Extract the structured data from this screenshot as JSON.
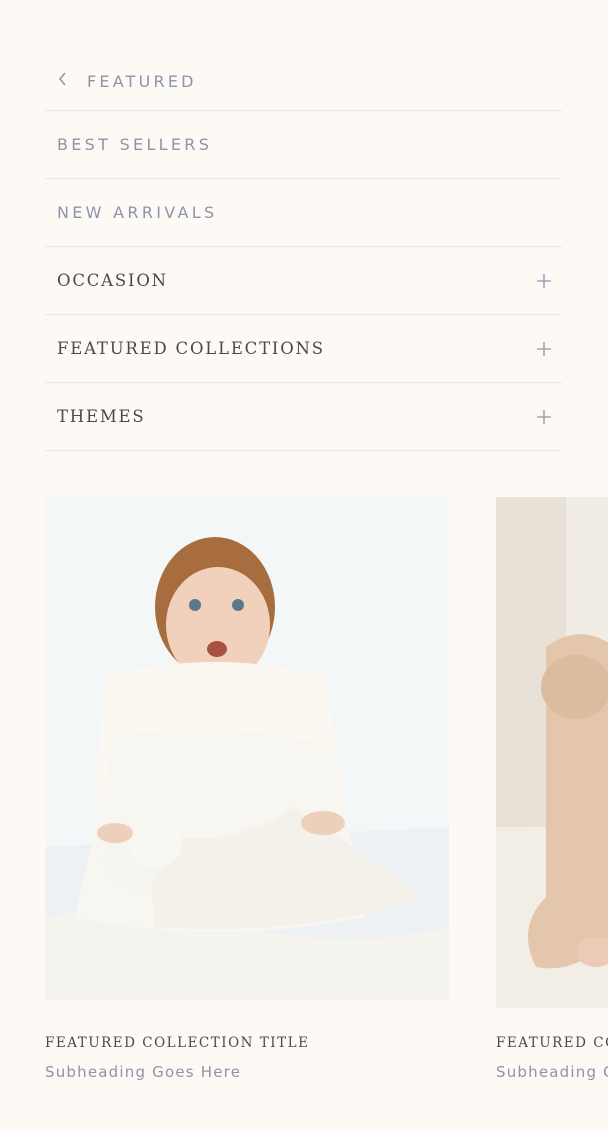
{
  "menu": {
    "back_label": "FEATURED",
    "items": [
      {
        "label": "BEST SELLERS",
        "expandable": false
      },
      {
        "label": "NEW ARRIVALS",
        "expandable": false
      },
      {
        "label": "OCCASION",
        "expandable": true
      },
      {
        "label": "FEATURED COLLECTIONS",
        "expandable": true
      },
      {
        "label": "THEMES",
        "expandable": true
      }
    ]
  },
  "cards": [
    {
      "title": "FEATURED COLLECTION TITLE",
      "subheading": "Subheading Goes Here",
      "image": "baby-in-white-outfit-photo"
    },
    {
      "title": "FEATURED COLLECTION TITLE",
      "subheading": "Subheading Goes Here",
      "image": "baby-in-beige-outfit-photo"
    }
  ],
  "colors": {
    "background": "#fdfaf5",
    "accent": "#8e93aa",
    "text": "#4a4a4a",
    "divider": "#ebe7e1"
  }
}
